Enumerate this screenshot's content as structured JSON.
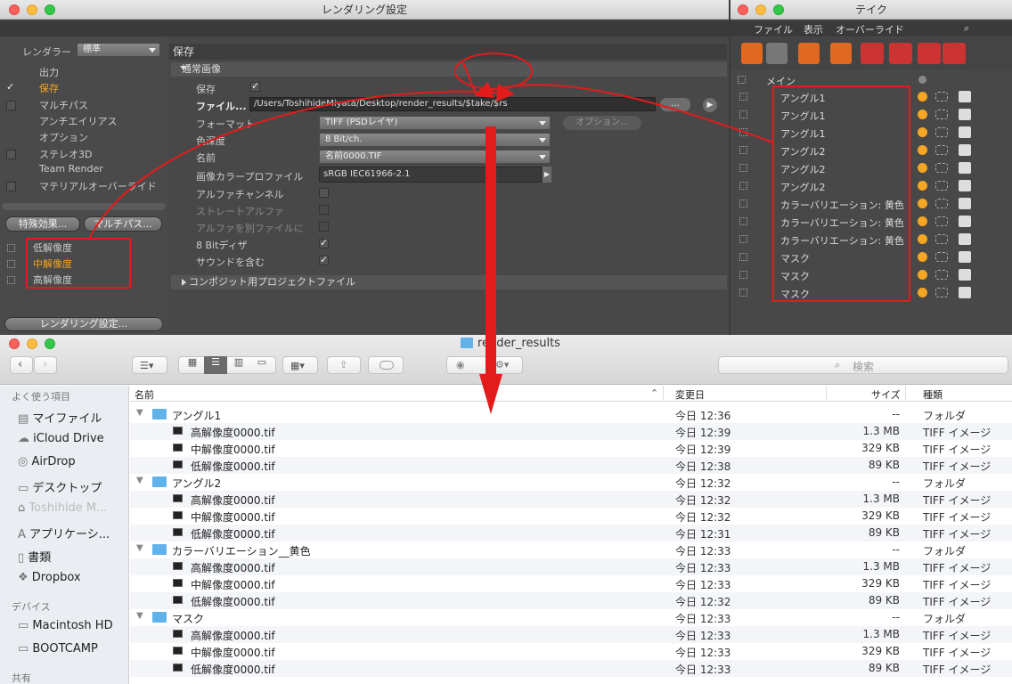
{
  "render": {
    "title": "レンダリング設定",
    "renderer_label": "レンダラー",
    "renderer_value": "標準",
    "nav": [
      "出力",
      "保存",
      "マルチパス",
      "アンチエイリアス",
      "オプション",
      "ステレオ3D",
      "Team Render",
      "マテリアルオーバーライド"
    ],
    "special_btn": "特殊効果...",
    "multipass_btn": "マルチパス...",
    "presets": [
      "低解像度",
      "中解像度",
      "高解像度"
    ],
    "render_settings_btn": "レンダリング設定...",
    "section": "保存",
    "subsection": "通常画像",
    "save_label": "保存",
    "file_label": "ファイル...",
    "file_path": "/Users/ToshihideMiyata/Desktop/render_results/$take/$rs",
    "file_btn": "...",
    "format_label": "フォーマット",
    "format_value": "TIFF (PSDレイヤ)",
    "options_btn": "オプション...",
    "depth_label": "色深度",
    "depth_value": "8 Bit/ch.",
    "name_label": "名前",
    "name_value": "名前0000.TIF",
    "profile_label": "画像カラープロファイル",
    "profile_value": "sRGB IEC61966-2.1",
    "alpha_label": "アルファチャンネル",
    "straight_label": "ストレートアルファ",
    "separate_label": "アルファを別ファイルに",
    "dither_label": "8 Bitディザ",
    "sound_label": "サウンドを含む",
    "composite_label": "コンポジット用プロジェクトファイル"
  },
  "take": {
    "title": "テイク",
    "menu": [
      "ファイル",
      "表示",
      "オーバーライド"
    ],
    "main": "メイン",
    "rows": [
      "アングル1",
      "アングル1",
      "アングル1",
      "アングル2",
      "アングル2",
      "アングル2",
      "カラーバリエーション: 黄色",
      "カラーバリエーション: 黄色",
      "カラーバリエーション: 黄色",
      "マスク",
      "マスク",
      "マスク"
    ]
  },
  "finder": {
    "title": "render_results",
    "search_placeholder": "検索",
    "sidebar": {
      "favorites": "よく使う項目",
      "items": [
        "マイファイル",
        "iCloud Drive",
        "AirDrop",
        "デスクトップ",
        "Toshihide M...",
        "アプリケーシ...",
        "書類",
        "Dropbox"
      ],
      "devices": "デバイス",
      "device_items": [
        "Macintosh HD",
        "BOOTCAMP"
      ],
      "shared": "共有"
    },
    "headers": {
      "name": "名前",
      "modified": "変更日",
      "size": "サイズ",
      "kind": "種類"
    },
    "rows": [
      {
        "name": "アングル1",
        "date": "今日 12:36",
        "size": "--",
        "kind": "フォルダ",
        "folder": true
      },
      {
        "name": "高解像度0000.tif",
        "date": "今日 12:39",
        "size": "1.3 MB",
        "kind": "TIFF イメージ"
      },
      {
        "name": "中解像度0000.tif",
        "date": "今日 12:39",
        "size": "329 KB",
        "kind": "TIFF イメージ"
      },
      {
        "name": "低解像度0000.tif",
        "date": "今日 12:38",
        "size": "89 KB",
        "kind": "TIFF イメージ"
      },
      {
        "name": "アングル2",
        "date": "今日 12:32",
        "size": "--",
        "kind": "フォルダ",
        "folder": true
      },
      {
        "name": "高解像度0000.tif",
        "date": "今日 12:32",
        "size": "1.3 MB",
        "kind": "TIFF イメージ"
      },
      {
        "name": "中解像度0000.tif",
        "date": "今日 12:32",
        "size": "329 KB",
        "kind": "TIFF イメージ"
      },
      {
        "name": "低解像度0000.tif",
        "date": "今日 12:31",
        "size": "89 KB",
        "kind": "TIFF イメージ"
      },
      {
        "name": "カラーバリエーション__黄色",
        "date": "今日 12:33",
        "size": "--",
        "kind": "フォルダ",
        "folder": true
      },
      {
        "name": "高解像度0000.tif",
        "date": "今日 12:33",
        "size": "1.3 MB",
        "kind": "TIFF イメージ"
      },
      {
        "name": "中解像度0000.tif",
        "date": "今日 12:33",
        "size": "329 KB",
        "kind": "TIFF イメージ"
      },
      {
        "name": "低解像度0000.tif",
        "date": "今日 12:32",
        "size": "89 KB",
        "kind": "TIFF イメージ"
      },
      {
        "name": "マスク",
        "date": "今日 12:33",
        "size": "--",
        "kind": "フォルダ",
        "folder": true
      },
      {
        "name": "高解像度0000.tif",
        "date": "今日 12:33",
        "size": "1.3 MB",
        "kind": "TIFF イメージ"
      },
      {
        "name": "中解像度0000.tif",
        "date": "今日 12:33",
        "size": "329 KB",
        "kind": "TIFF イメージ"
      },
      {
        "name": "低解像度0000.tif",
        "date": "今日 12:33",
        "size": "89 KB",
        "kind": "TIFF イメージ"
      }
    ]
  }
}
